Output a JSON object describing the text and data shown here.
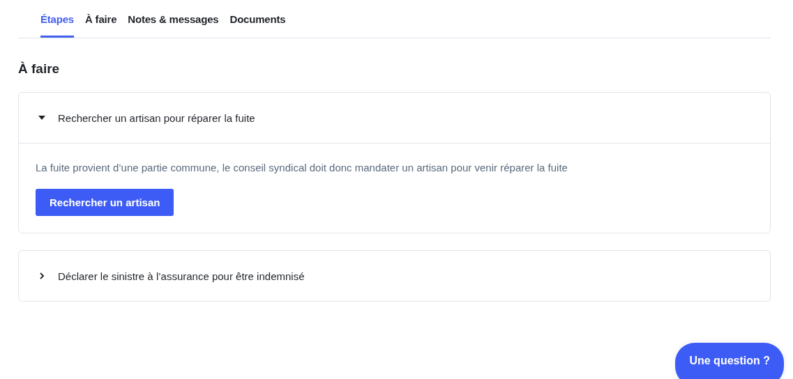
{
  "tabs": [
    {
      "label": "Étapes",
      "selected": true
    },
    {
      "label": "À faire",
      "selected": false
    },
    {
      "label": "Notes & messages",
      "selected": false
    },
    {
      "label": "Documents",
      "selected": false
    }
  ],
  "section": {
    "title": "À faire"
  },
  "tasks": [
    {
      "title": "Rechercher un artisan pour réparer la fuite",
      "expanded": true,
      "description": "La fuite provient d’une partie commune, le conseil syndical doit donc mandater un artisan pour venir réparer la fuite",
      "action": "Rechercher un artisan"
    },
    {
      "title": "Déclarer le sinistre à l’assurance pour être indemnisé",
      "expanded": false
    }
  ],
  "help_button": "Une question ?"
}
